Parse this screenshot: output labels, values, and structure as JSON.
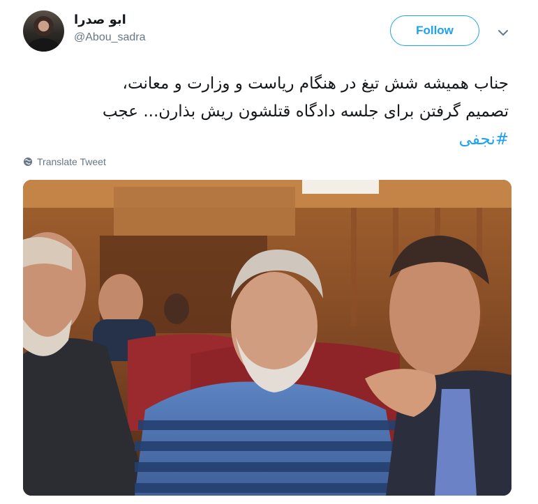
{
  "user": {
    "display_name": "ابو صدرا",
    "handle": "@Abou_sadra"
  },
  "follow_label": "Follow",
  "tweet": {
    "line1": "جناب همیشه شش تیغ در هنگام ریاست و وزارت و معانت،",
    "line2": "تصمیم گرفتن برای جلسه دادگاه قتلشون ریش بذارن... عجب",
    "hashtag": "#نجفی"
  },
  "translate_label": "Translate Tweet",
  "icons": {
    "caret": "chevron-down-icon",
    "translate": "globe-icon"
  },
  "colors": {
    "accent": "#1da1f2",
    "secondary_text": "#657786"
  }
}
